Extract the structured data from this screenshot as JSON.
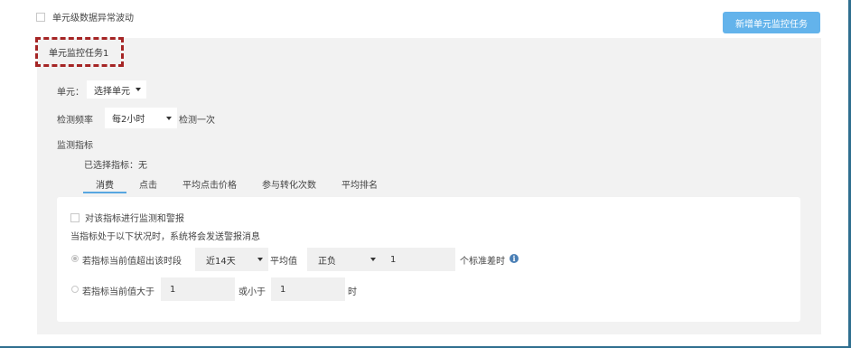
{
  "top": {
    "anomaly_label": "单元级数据异常波动",
    "add_button": "新增单元监控任务"
  },
  "task": {
    "title": "单元监控任务1",
    "unit_label": "单元：",
    "unit_select": "选择单元",
    "freq_label": "检测频率",
    "freq_value": "每2小时",
    "freq_suffix": "检测一次",
    "metric_label": "监测指标",
    "selected_metrics": "已选择指标：无"
  },
  "tabs": [
    "消费",
    "点击",
    "平均点击价格",
    "参与转化次数",
    "平均排名"
  ],
  "card": {
    "enable_label": "对该指标进行监测和警报",
    "condition_text": "当指标处于以下状况时，系统将会发送警报消息",
    "rule1": {
      "prefix": "若指标当前值超出该时段",
      "period": "近14天",
      "avg_label": "平均值",
      "direction": "正负",
      "value": "1",
      "suffix": "个标准差时"
    },
    "rule2": {
      "prefix": "若指标当前值大于",
      "value_gt": "1",
      "or_less": "或小于",
      "value_lt": "1",
      "suffix": "时"
    }
  }
}
